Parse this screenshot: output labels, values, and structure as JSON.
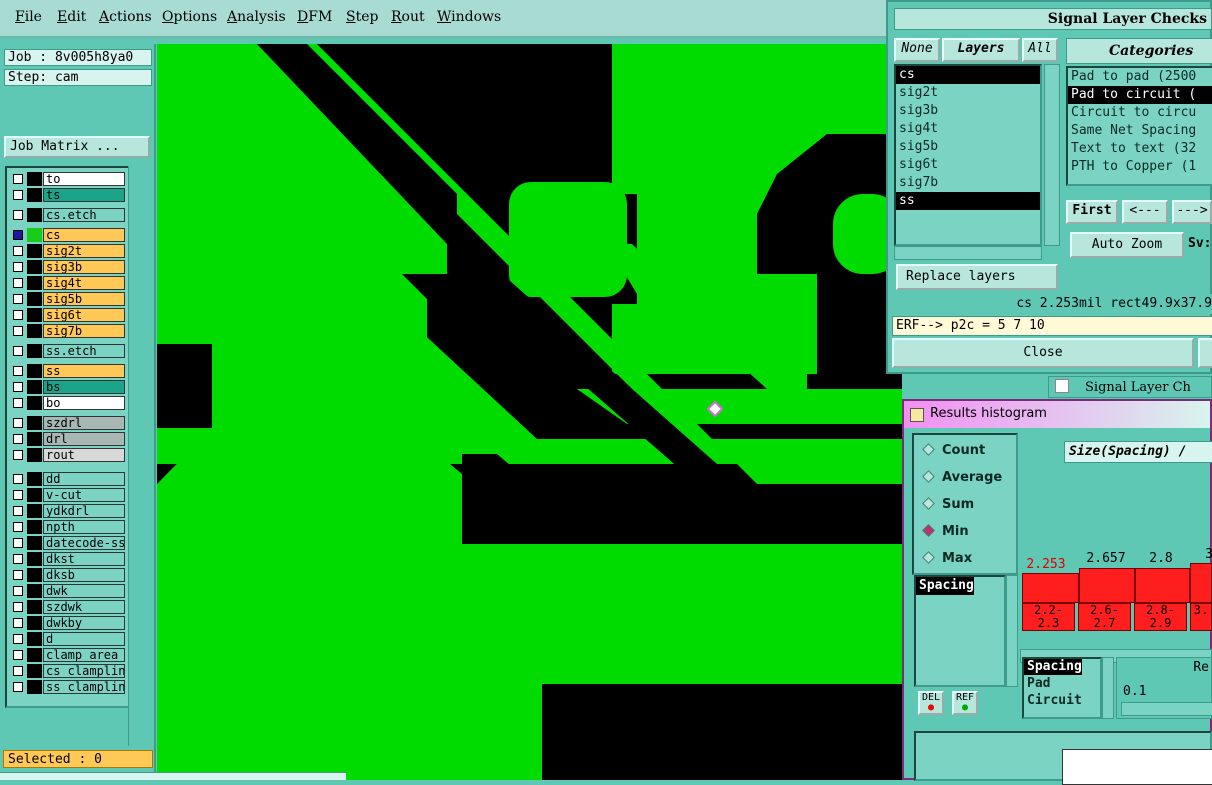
{
  "menubar": {
    "items": [
      "File",
      "Edit",
      "Actions",
      "Options",
      "Analysis",
      "DFM",
      "Step",
      "Rout",
      "Windows"
    ]
  },
  "left_panel": {
    "job": "Job : 8v005h8ya0",
    "step": "Step: cam",
    "job_matrix_button": "Job Matrix ...",
    "layers": [
      {
        "name": "to",
        "color": "#ffffff"
      },
      {
        "name": "ts",
        "color": "#1aa58a"
      },
      {
        "name": "cs.etch",
        "color": "#7bd4c3"
      },
      {
        "name": "cs",
        "color": "#ffc857"
      },
      {
        "name": "sig2t",
        "color": "#ffc857"
      },
      {
        "name": "sig3b",
        "color": "#ffc857"
      },
      {
        "name": "sig4t",
        "color": "#ffc857"
      },
      {
        "name": "sig5b",
        "color": "#ffc857"
      },
      {
        "name": "sig6t",
        "color": "#ffc857"
      },
      {
        "name": "sig7b",
        "color": "#ffc857"
      },
      {
        "name": "ss.etch",
        "color": "#7bd4c3"
      },
      {
        "name": "ss",
        "color": "#ffc857"
      },
      {
        "name": "bs",
        "color": "#1aa58a"
      },
      {
        "name": "bo",
        "color": "#ffffff"
      },
      {
        "name": "szdrl",
        "color": "#a7b8b4"
      },
      {
        "name": "drl",
        "color": "#a7b8b4"
      },
      {
        "name": "rout",
        "color": "#d8d8d8"
      },
      {
        "name": "dd",
        "color": "#7bd4c3"
      },
      {
        "name": "v-cut",
        "color": "#7bd4c3"
      },
      {
        "name": "ydkdrl",
        "color": "#7bd4c3"
      },
      {
        "name": "npth",
        "color": "#7bd4c3"
      },
      {
        "name": "datecode-ss",
        "color": "#7bd4c3"
      },
      {
        "name": "dkst",
        "color": "#7bd4c3"
      },
      {
        "name": "dksb",
        "color": "#7bd4c3"
      },
      {
        "name": "dwk",
        "color": "#7bd4c3"
      },
      {
        "name": "szdwk",
        "color": "#7bd4c3"
      },
      {
        "name": "dwkby",
        "color": "#7bd4c3"
      },
      {
        "name": "d",
        "color": "#7bd4c3"
      },
      {
        "name": "clamp_area",
        "color": "#7bd4c3"
      },
      {
        "name": "cs_clampline",
        "color": "#7bd4c3"
      },
      {
        "name": "ss_clampline",
        "color": "#7bd4c3"
      }
    ],
    "selected": "Selected : 0"
  },
  "signal_checks": {
    "title": "Signal Layer Checks",
    "none_button": "None",
    "layers_button": "Layers",
    "all_button": "All",
    "layer_items": [
      "cs",
      "sig2t",
      "sig3b",
      "sig4t",
      "sig5b",
      "sig6t",
      "sig7b",
      "ss"
    ],
    "categories_title": "Categories",
    "categories": [
      "Pad to pad (2500",
      "Pad to circuit (",
      "Circuit to circu",
      "Same Net Spacing",
      "Text to text (32",
      "PTH to Copper (1"
    ],
    "replace_button": "Replace layers",
    "first_button": "First",
    "prev_button": "<---",
    "next_button": "--->",
    "auto_zoom": "Auto Zoom",
    "sv_label": "Sv:",
    "status": "cs 2.253mil  rect49.9x37.9",
    "erf": "ERF--> p2c = 5 7 10",
    "close_button": "Close",
    "second_window_title": "Signal Layer Ch"
  },
  "histogram": {
    "title": "Results histogram",
    "options": [
      "Count",
      "Average",
      "Sum",
      "Min",
      "Max"
    ],
    "selected_option": "Min",
    "axis_label": "Size(Spacing) / ",
    "bar_values": [
      "2.253",
      "2.657",
      "2.8",
      "3"
    ],
    "bins": [
      [
        "2.2-",
        "2.3"
      ],
      [
        "2.6-",
        "2.7"
      ],
      [
        "2.8-",
        "2.9"
      ],
      [
        "3.",
        ""
      ]
    ],
    "spacing_item": "Spacing",
    "bottom_list": [
      "Spacing",
      "Pad",
      "Circuit"
    ],
    "re_label": "Re",
    "value_field": "0.1",
    "del_button": "DEL",
    "ref_button": "REF"
  }
}
